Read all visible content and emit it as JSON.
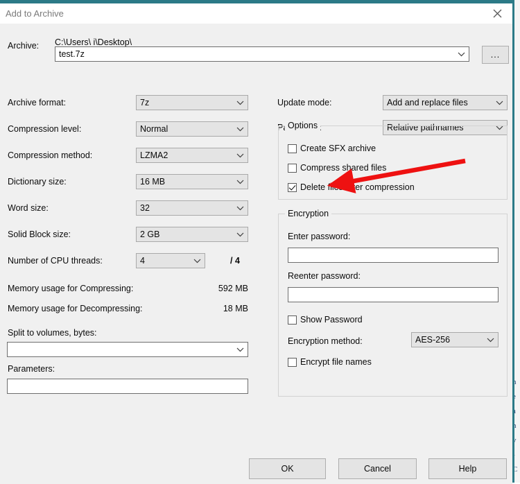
{
  "backdrop": {
    "edge_text_fragments": [
      "t",
      "h",
      "e",
      "a",
      "h",
      "v",
      "-",
      "C"
    ]
  },
  "dialog": {
    "title": "Add to Archive",
    "close_icon": "close-icon",
    "archive": {
      "label": "Archive:",
      "path": "C:\\Users\\          i\\Desktop\\",
      "filename": "test.7z",
      "browse_label": "..."
    },
    "left_fields": [
      {
        "label": "Archive format:",
        "value": "7z"
      },
      {
        "label": "Compression level:",
        "value": "Normal"
      },
      {
        "label": "Compression method:",
        "value": "LZMA2"
      },
      {
        "label": "Dictionary size:",
        "value": "16 MB"
      },
      {
        "label": "Word size:",
        "value": "32"
      },
      {
        "label": "Solid Block size:",
        "value": "2 GB"
      }
    ],
    "cpu_threads": {
      "label": "Number of CPU threads:",
      "value": "4",
      "total": "/ 4"
    },
    "memory": [
      {
        "label": "Memory usage for Compressing:",
        "value": "592 MB"
      },
      {
        "label": "Memory usage for Decompressing:",
        "value": "18 MB"
      }
    ],
    "split": {
      "label": "Split to volumes, bytes:",
      "value": ""
    },
    "parameters": {
      "label": "Parameters:",
      "value": ""
    },
    "right_fields": [
      {
        "label": "Update mode:",
        "value": "Add and replace files"
      },
      {
        "label": "Path mode:",
        "value": "Relative pathnames"
      }
    ],
    "options": {
      "title": "Options",
      "items": [
        {
          "label": "Create SFX archive",
          "checked": false
        },
        {
          "label": "Compress shared files",
          "checked": false
        },
        {
          "label": "Delete files after compression",
          "checked": true
        }
      ]
    },
    "encryption": {
      "title": "Encryption",
      "enter_password_label": "Enter password:",
      "enter_password_value": "",
      "reenter_password_label": "Reenter password:",
      "reenter_password_value": "",
      "show_password": {
        "label": "Show Password",
        "checked": false
      },
      "method_label": "Encryption method:",
      "method_value": "AES-256",
      "encrypt_file_names": {
        "label": "Encrypt file names",
        "checked": false
      }
    },
    "buttons": [
      {
        "label": "OK"
      },
      {
        "label": "Cancel"
      },
      {
        "label": "Help"
      }
    ]
  },
  "annotation": {
    "type": "arrow",
    "color": "#ee1111",
    "points_at": "Delete files after compression"
  }
}
